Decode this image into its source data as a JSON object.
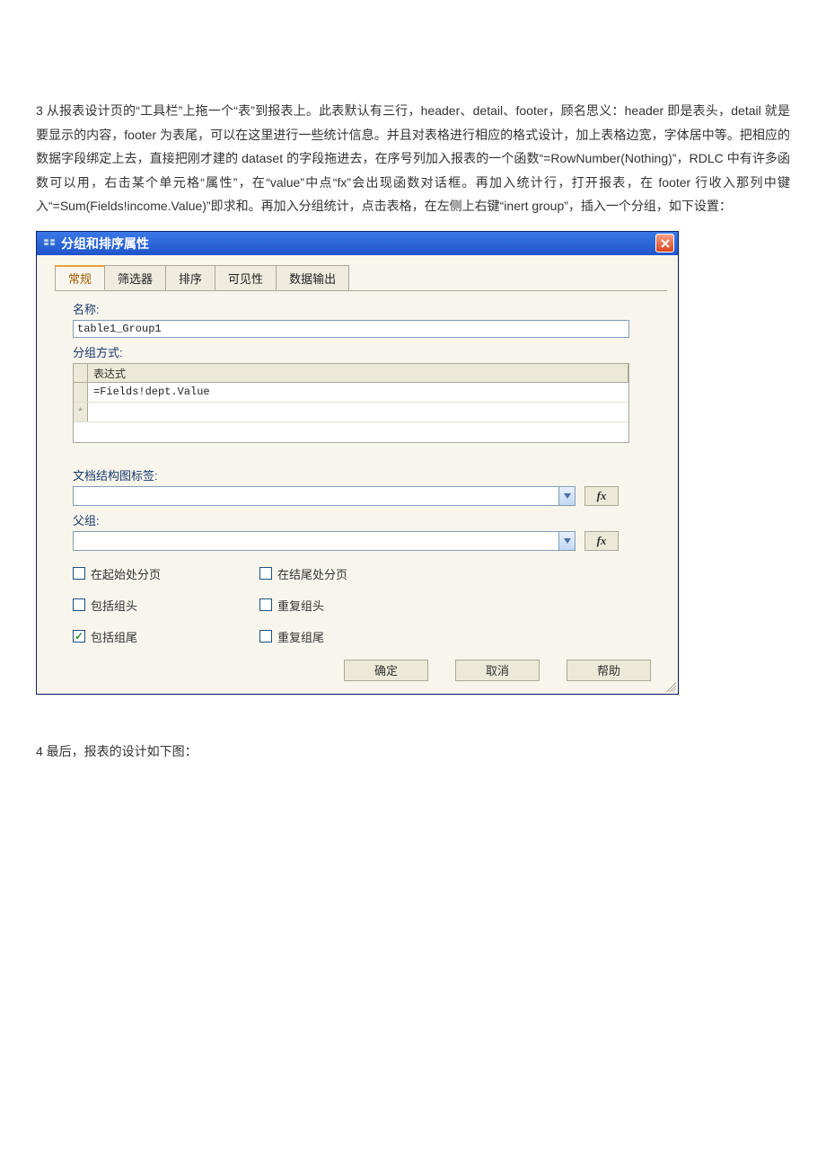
{
  "doc": {
    "para3": "3   从报表设计页的“工具栏”上拖一个“表”到报表上。此表默认有三行，header、detail、footer，顾名思义：header  即是表头，detail  就是要显示的内容，footer 为表尾，可以在这里进行一些统计信息。并且对表格进行相应的格式设计，加上表格边宽，字体居中等。把相应的数据字段绑定上去，直接把刚才建的  dataset  的字段拖进去，在序号列加入报表的一个函数“=RowNumber(Nothing)”，RDLC         中有许多函数可以用，右击某个单元格“属性”，在“value”中点“fx”会出现函数对话框。再加入统计行，打开报表，在            footer            行收入那列中键入“=Sum(Fields!income.Value)”即求和。再加入分组统计，点击表格，在左侧上右键“inert group”，插入一个分组，如下设置：",
    "para4": "4   最后，报表的设计如下图："
  },
  "dialog": {
    "title": "分组和排序属性",
    "tabs": [
      "常规",
      "筛选器",
      "排序",
      "可见性",
      "数据输出"
    ],
    "activeTab": 0,
    "labels": {
      "name": "名称:",
      "groupBy": "分组方式:",
      "expressionHeader": "表达式",
      "docMapLabel": "文档结构图标签:",
      "parentGroup": "父组:"
    },
    "values": {
      "name": "table1_Group1",
      "expression": "=Fields!dept.Value"
    },
    "checks": {
      "pageBreakStart": {
        "label": "在起始处分页",
        "checked": false
      },
      "pageBreakEnd": {
        "label": "在结尾处分页",
        "checked": false
      },
      "includeHeader": {
        "label": "包括组头",
        "checked": false
      },
      "repeatHeader": {
        "label": "重复组头",
        "checked": false
      },
      "includeFooter": {
        "label": "包括组尾",
        "checked": true
      },
      "repeatFooter": {
        "label": "重复组尾",
        "checked": false
      }
    },
    "buttons": {
      "ok": "确定",
      "cancel": "取消",
      "help": "帮助"
    },
    "fx": "fx"
  }
}
